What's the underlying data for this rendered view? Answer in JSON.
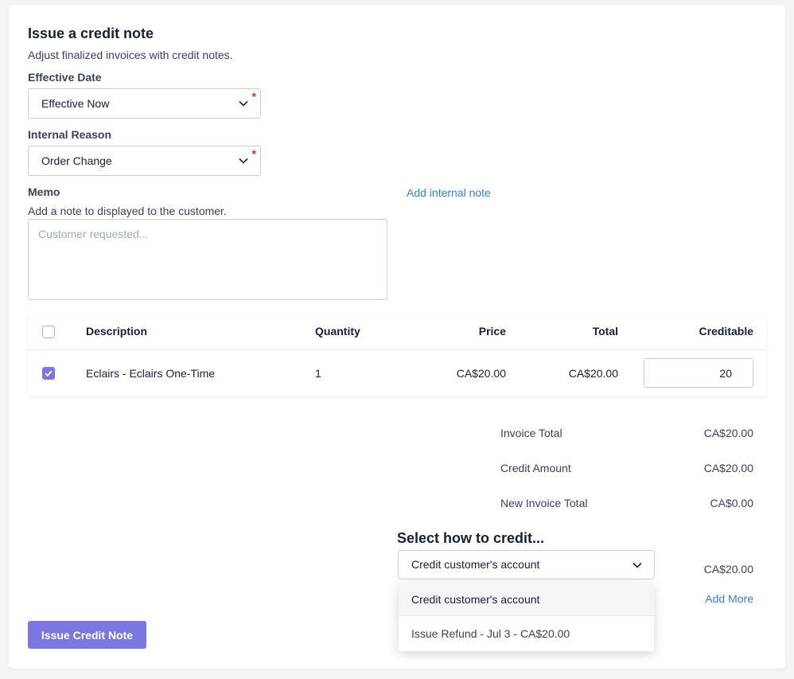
{
  "header": {
    "title": "Issue a credit note",
    "subtitle": "Adjust finalized invoices with credit notes."
  },
  "effective_date": {
    "label": "Effective Date",
    "value": "Effective Now",
    "required_mark": "*"
  },
  "internal_reason": {
    "label": "Internal Reason",
    "value": "Order Change",
    "required_mark": "*"
  },
  "memo": {
    "label": "Memo",
    "help": "Add a note to displayed to the customer.",
    "placeholder": "Customer requested...",
    "add_internal_note": "Add internal note"
  },
  "table": {
    "headers": {
      "description": "Description",
      "quantity": "Quantity",
      "price": "Price",
      "total": "Total",
      "creditable": "Creditable"
    },
    "rows": [
      {
        "checked": true,
        "description": "Eclairs - Eclairs One-Time",
        "quantity": "1",
        "price": "CA$20.00",
        "total": "CA$20.00",
        "creditable": "20"
      }
    ]
  },
  "summary": {
    "invoice_total_label": "Invoice Total",
    "invoice_total": "CA$20.00",
    "credit_amount_label": "Credit Amount",
    "credit_amount": "CA$20.00",
    "new_invoice_total_label": "New Invoice Total",
    "new_invoice_total": "CA$0.00"
  },
  "credit_method": {
    "heading": "Select how to credit...",
    "selected": "Credit customer's account",
    "amount": "CA$20.00",
    "add_more": "Add More",
    "options": [
      "Credit customer's account",
      "Issue Refund - Jul 3 - CA$20.00"
    ]
  },
  "actions": {
    "issue_label": "Issue Credit Note"
  },
  "colors": {
    "accent": "#7b76e0",
    "link": "#3d7fc4",
    "required": "#c0392b"
  }
}
